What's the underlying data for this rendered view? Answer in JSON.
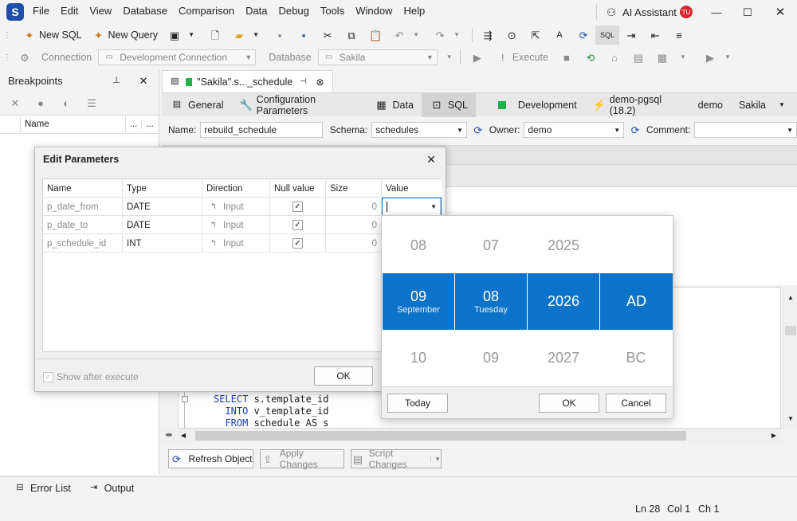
{
  "menu": {
    "items": [
      "File",
      "Edit",
      "View",
      "Database",
      "Comparison",
      "Data",
      "Debug",
      "Tools",
      "Window",
      "Help"
    ],
    "ai_assistant": "AI Assistant",
    "user_initials": "TU"
  },
  "toolbar1": {
    "new_sql": "New SQL",
    "new_query": "New Query"
  },
  "toolbar2": {
    "connection_label": "Connection",
    "connection_value": "Development Connection",
    "database_label": "Database",
    "database_value": "Sakila",
    "execute": "Execute"
  },
  "breakpoints": {
    "title": "Breakpoints",
    "column_name": "Name",
    "col_dots1": "...",
    "col_dots2": "..."
  },
  "document": {
    "tab_title": "\"Sakila\".s..._schedule",
    "subtabs": {
      "general": "General",
      "config": "Configuration Parameters",
      "data": "Data",
      "sql": "SQL"
    },
    "env": "Development",
    "connection": "demo-pgsql (18.2)",
    "user": "demo",
    "database": "Sakila",
    "form": {
      "name_label": "Name:",
      "name_value": "rebuild_schedule",
      "schema_label": "Schema:",
      "schema_value": "schedules",
      "owner_label": "Owner:",
      "owner_value": "demo",
      "comment_label": "Comment:",
      "comment_value": ""
    },
    "code_lines": [
      {
        "kw": "SELECT",
        "rest": " s.template_id"
      },
      {
        "kw": "  INTO",
        "rest": " v_template_id"
      },
      {
        "kw": "  FROM",
        "rest": " schedule AS s"
      }
    ],
    "bottom_buttons": {
      "refresh": "Refresh Object",
      "apply": "Apply Changes",
      "script": "Script Changes"
    }
  },
  "dialog": {
    "title": "Edit Parameters",
    "columns": [
      "Name",
      "Type",
      "Direction",
      "Null value",
      "Size",
      "Value"
    ],
    "rows": [
      {
        "name": "p_date_from",
        "type": "DATE",
        "direction": "Input",
        "null": true,
        "size": "0",
        "value": ""
      },
      {
        "name": "p_date_to",
        "type": "DATE",
        "direction": "Input",
        "null": true,
        "size": "0",
        "value": ""
      },
      {
        "name": "p_schedule_id",
        "type": "INT",
        "direction": "Input",
        "null": true,
        "size": "0",
        "value": ""
      }
    ],
    "show_after_execute": "Show after execute",
    "ok": "OK"
  },
  "date_picker": {
    "prev_row": [
      "08",
      "07",
      "2025",
      ""
    ],
    "selected": [
      {
        "big": "09",
        "small": "September"
      },
      {
        "big": "08",
        "small": "Tuesday"
      },
      {
        "big": "2026",
        "small": ""
      },
      {
        "big": "AD",
        "small": ""
      }
    ],
    "next_row": [
      "10",
      "09",
      "2027",
      "BC"
    ],
    "today": "Today",
    "ok": "OK",
    "cancel": "Cancel"
  },
  "bottom_tabs": {
    "error_list": "Error List",
    "output": "Output"
  },
  "status": {
    "ln": "Ln 28",
    "col": "Col 1",
    "ch": "Ch 1"
  },
  "colors": {
    "accent": "#0b73c9",
    "green_status": "#22b14c",
    "user_badge": "#d8262e"
  }
}
